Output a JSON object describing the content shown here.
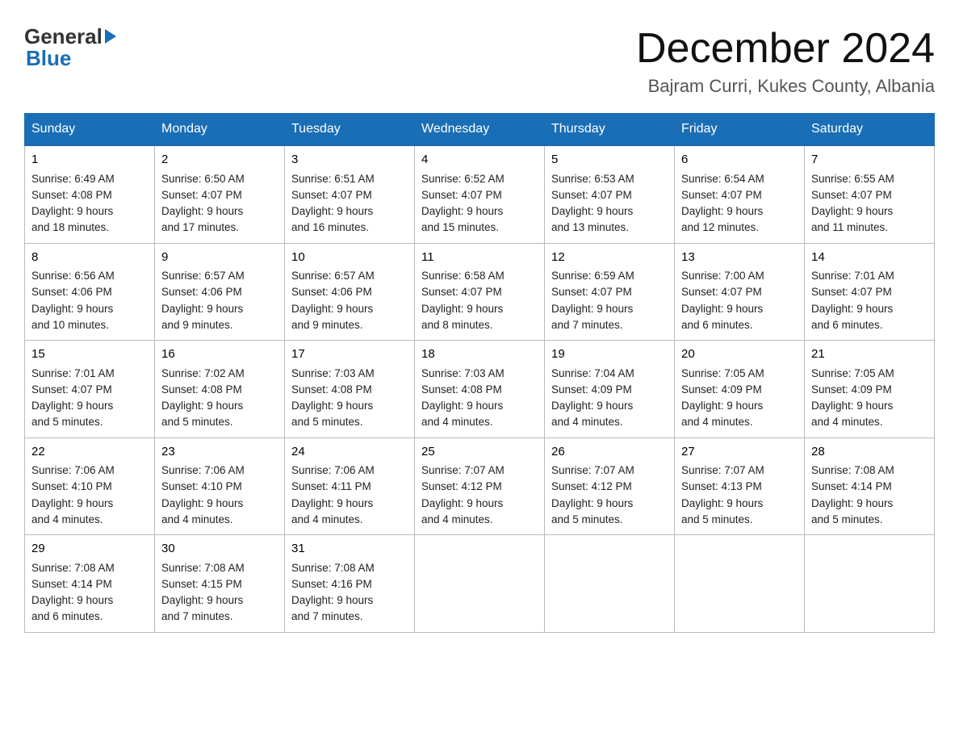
{
  "header": {
    "logo_general": "General",
    "logo_blue": "Blue",
    "main_title": "December 2024",
    "subtitle": "Bajram Curri, Kukes County, Albania"
  },
  "days_of_week": [
    "Sunday",
    "Monday",
    "Tuesday",
    "Wednesday",
    "Thursday",
    "Friday",
    "Saturday"
  ],
  "weeks": [
    [
      {
        "day": "1",
        "sunrise": "Sunrise: 6:49 AM",
        "sunset": "Sunset: 4:08 PM",
        "daylight": "Daylight: 9 hours",
        "daylight2": "and 18 minutes."
      },
      {
        "day": "2",
        "sunrise": "Sunrise: 6:50 AM",
        "sunset": "Sunset: 4:07 PM",
        "daylight": "Daylight: 9 hours",
        "daylight2": "and 17 minutes."
      },
      {
        "day": "3",
        "sunrise": "Sunrise: 6:51 AM",
        "sunset": "Sunset: 4:07 PM",
        "daylight": "Daylight: 9 hours",
        "daylight2": "and 16 minutes."
      },
      {
        "day": "4",
        "sunrise": "Sunrise: 6:52 AM",
        "sunset": "Sunset: 4:07 PM",
        "daylight": "Daylight: 9 hours",
        "daylight2": "and 15 minutes."
      },
      {
        "day": "5",
        "sunrise": "Sunrise: 6:53 AM",
        "sunset": "Sunset: 4:07 PM",
        "daylight": "Daylight: 9 hours",
        "daylight2": "and 13 minutes."
      },
      {
        "day": "6",
        "sunrise": "Sunrise: 6:54 AM",
        "sunset": "Sunset: 4:07 PM",
        "daylight": "Daylight: 9 hours",
        "daylight2": "and 12 minutes."
      },
      {
        "day": "7",
        "sunrise": "Sunrise: 6:55 AM",
        "sunset": "Sunset: 4:07 PM",
        "daylight": "Daylight: 9 hours",
        "daylight2": "and 11 minutes."
      }
    ],
    [
      {
        "day": "8",
        "sunrise": "Sunrise: 6:56 AM",
        "sunset": "Sunset: 4:06 PM",
        "daylight": "Daylight: 9 hours",
        "daylight2": "and 10 minutes."
      },
      {
        "day": "9",
        "sunrise": "Sunrise: 6:57 AM",
        "sunset": "Sunset: 4:06 PM",
        "daylight": "Daylight: 9 hours",
        "daylight2": "and 9 minutes."
      },
      {
        "day": "10",
        "sunrise": "Sunrise: 6:57 AM",
        "sunset": "Sunset: 4:06 PM",
        "daylight": "Daylight: 9 hours",
        "daylight2": "and 9 minutes."
      },
      {
        "day": "11",
        "sunrise": "Sunrise: 6:58 AM",
        "sunset": "Sunset: 4:07 PM",
        "daylight": "Daylight: 9 hours",
        "daylight2": "and 8 minutes."
      },
      {
        "day": "12",
        "sunrise": "Sunrise: 6:59 AM",
        "sunset": "Sunset: 4:07 PM",
        "daylight": "Daylight: 9 hours",
        "daylight2": "and 7 minutes."
      },
      {
        "day": "13",
        "sunrise": "Sunrise: 7:00 AM",
        "sunset": "Sunset: 4:07 PM",
        "daylight": "Daylight: 9 hours",
        "daylight2": "and 6 minutes."
      },
      {
        "day": "14",
        "sunrise": "Sunrise: 7:01 AM",
        "sunset": "Sunset: 4:07 PM",
        "daylight": "Daylight: 9 hours",
        "daylight2": "and 6 minutes."
      }
    ],
    [
      {
        "day": "15",
        "sunrise": "Sunrise: 7:01 AM",
        "sunset": "Sunset: 4:07 PM",
        "daylight": "Daylight: 9 hours",
        "daylight2": "and 5 minutes."
      },
      {
        "day": "16",
        "sunrise": "Sunrise: 7:02 AM",
        "sunset": "Sunset: 4:08 PM",
        "daylight": "Daylight: 9 hours",
        "daylight2": "and 5 minutes."
      },
      {
        "day": "17",
        "sunrise": "Sunrise: 7:03 AM",
        "sunset": "Sunset: 4:08 PM",
        "daylight": "Daylight: 9 hours",
        "daylight2": "and 5 minutes."
      },
      {
        "day": "18",
        "sunrise": "Sunrise: 7:03 AM",
        "sunset": "Sunset: 4:08 PM",
        "daylight": "Daylight: 9 hours",
        "daylight2": "and 4 minutes."
      },
      {
        "day": "19",
        "sunrise": "Sunrise: 7:04 AM",
        "sunset": "Sunset: 4:09 PM",
        "daylight": "Daylight: 9 hours",
        "daylight2": "and 4 minutes."
      },
      {
        "day": "20",
        "sunrise": "Sunrise: 7:05 AM",
        "sunset": "Sunset: 4:09 PM",
        "daylight": "Daylight: 9 hours",
        "daylight2": "and 4 minutes."
      },
      {
        "day": "21",
        "sunrise": "Sunrise: 7:05 AM",
        "sunset": "Sunset: 4:09 PM",
        "daylight": "Daylight: 9 hours",
        "daylight2": "and 4 minutes."
      }
    ],
    [
      {
        "day": "22",
        "sunrise": "Sunrise: 7:06 AM",
        "sunset": "Sunset: 4:10 PM",
        "daylight": "Daylight: 9 hours",
        "daylight2": "and 4 minutes."
      },
      {
        "day": "23",
        "sunrise": "Sunrise: 7:06 AM",
        "sunset": "Sunset: 4:10 PM",
        "daylight": "Daylight: 9 hours",
        "daylight2": "and 4 minutes."
      },
      {
        "day": "24",
        "sunrise": "Sunrise: 7:06 AM",
        "sunset": "Sunset: 4:11 PM",
        "daylight": "Daylight: 9 hours",
        "daylight2": "and 4 minutes."
      },
      {
        "day": "25",
        "sunrise": "Sunrise: 7:07 AM",
        "sunset": "Sunset: 4:12 PM",
        "daylight": "Daylight: 9 hours",
        "daylight2": "and 4 minutes."
      },
      {
        "day": "26",
        "sunrise": "Sunrise: 7:07 AM",
        "sunset": "Sunset: 4:12 PM",
        "daylight": "Daylight: 9 hours",
        "daylight2": "and 5 minutes."
      },
      {
        "day": "27",
        "sunrise": "Sunrise: 7:07 AM",
        "sunset": "Sunset: 4:13 PM",
        "daylight": "Daylight: 9 hours",
        "daylight2": "and 5 minutes."
      },
      {
        "day": "28",
        "sunrise": "Sunrise: 7:08 AM",
        "sunset": "Sunset: 4:14 PM",
        "daylight": "Daylight: 9 hours",
        "daylight2": "and 5 minutes."
      }
    ],
    [
      {
        "day": "29",
        "sunrise": "Sunrise: 7:08 AM",
        "sunset": "Sunset: 4:14 PM",
        "daylight": "Daylight: 9 hours",
        "daylight2": "and 6 minutes."
      },
      {
        "day": "30",
        "sunrise": "Sunrise: 7:08 AM",
        "sunset": "Sunset: 4:15 PM",
        "daylight": "Daylight: 9 hours",
        "daylight2": "and 7 minutes."
      },
      {
        "day": "31",
        "sunrise": "Sunrise: 7:08 AM",
        "sunset": "Sunset: 4:16 PM",
        "daylight": "Daylight: 9 hours",
        "daylight2": "and 7 minutes."
      },
      null,
      null,
      null,
      null
    ]
  ]
}
